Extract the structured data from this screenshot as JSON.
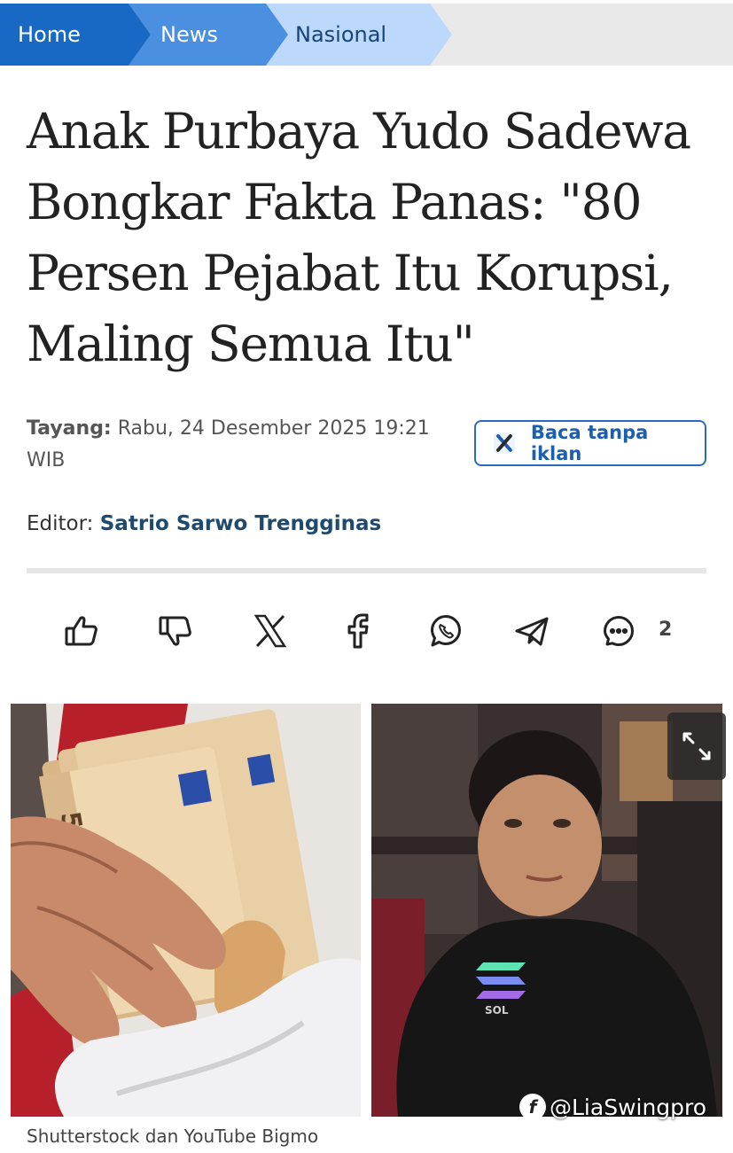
{
  "breadcrumb": {
    "items": [
      {
        "label": "Home"
      },
      {
        "label": "News"
      },
      {
        "label": "Nasional"
      }
    ]
  },
  "article": {
    "title": "Anak Purbaya Yudo Sadewa Bongkar Fakta Panas: \"80 Persen Pejabat Itu Korupsi, Maling Semua Itu\"",
    "published_label": "Tayang:",
    "published_value": "Rabu, 24 Desember 2025 19:21 WIB",
    "adfree_button": "Baca tanpa iklan",
    "editor_label": "Editor:",
    "editor_name": "Satrio Sarwo Trengginas"
  },
  "actions": {
    "items": [
      {
        "icon": "thumbs-up-icon"
      },
      {
        "icon": "thumbs-down-icon"
      },
      {
        "icon": "x-share-icon"
      },
      {
        "icon": "facebook-share-icon"
      },
      {
        "icon": "whatsapp-share-icon"
      },
      {
        "icon": "telegram-share-icon"
      },
      {
        "icon": "comment-icon"
      }
    ],
    "comment_count": "2"
  },
  "media": {
    "caption": "Shutterstock dan YouTube Bigmo",
    "watermark": "@LiaSwingpro",
    "watermark_logo": "f",
    "banknote_text": "50",
    "shirt_logo_text": "SOL"
  },
  "colors": {
    "breadcrumb_home": "#1769c4",
    "breadcrumb_news": "#4a8fe0",
    "breadcrumb_nasional": "#bcd9fb",
    "link": "#1c5fae"
  }
}
